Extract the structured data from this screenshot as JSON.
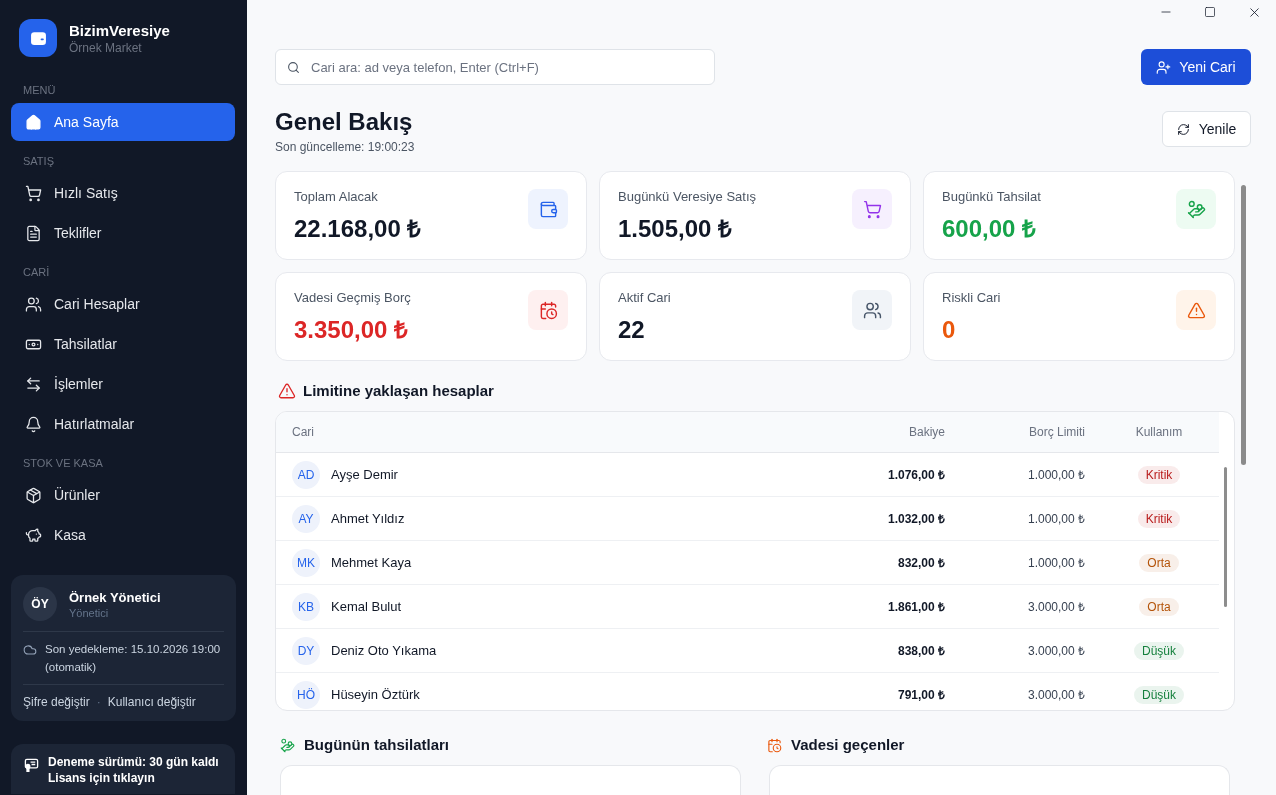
{
  "sidebar": {
    "app_name": "BizimVeresiye",
    "store_name": "Örnek Market",
    "sections": [
      {
        "label": "MENÜ",
        "items": [
          {
            "label": "Ana Sayfa",
            "selected": true
          }
        ]
      },
      {
        "label": "SATIŞ",
        "items": [
          {
            "label": "Hızlı Satış",
            "selected": false
          },
          {
            "label": "Teklifler",
            "selected": false
          }
        ]
      },
      {
        "label": "CARİ",
        "items": [
          {
            "label": "Cari Hesaplar",
            "selected": false
          },
          {
            "label": "Tahsilatlar",
            "selected": false
          },
          {
            "label": "İşlemler",
            "selected": false
          },
          {
            "label": "Hatırlatmalar",
            "selected": false
          }
        ]
      },
      {
        "label": "STOK VE KASA",
        "items": [
          {
            "label": "Ürünler",
            "selected": false
          },
          {
            "label": "Kasa",
            "selected": false
          }
        ]
      }
    ],
    "user": {
      "initials": "ÖY",
      "name": "Örnek Yönetici",
      "role": "Yönetici",
      "backup": "Son yedekleme: 15.10.2026 19:00 (otomatik)",
      "links": [
        "Şifre değiştir",
        "Kullanıcı değiştir"
      ],
      "link_separator": "·"
    },
    "trial": {
      "title": "Deneme sürümü: 30 gün kaldı",
      "action": "Lisans için tıklayın"
    }
  },
  "search": {
    "placeholder": "Cari ara: ad veya telefon, Enter (Ctrl+F)"
  },
  "new_account_button": "Yeni Cari",
  "header": {
    "title": "Genel Bakış",
    "updated": "Son güncelleme: 19:00:23",
    "refresh_button": "Yenile"
  },
  "stats": [
    {
      "label": "Toplam Alacak",
      "value": "22.168,00 ₺",
      "color": "#111827"
    },
    {
      "label": "Bugünkü Veresiye Satış",
      "value": "1.505,00 ₺",
      "color": "#111827"
    },
    {
      "label": "Bugünkü Tahsilat",
      "value": "600,00 ₺",
      "color": "#16a34a"
    },
    {
      "label": "Vadesi Geçmiş Borç",
      "value": "3.350,00 ₺",
      "color": "#dc2626"
    },
    {
      "label": "Aktif Cari",
      "value": "22",
      "color": "#111827"
    },
    {
      "label": "Riskli Cari",
      "value": "0",
      "color": "#ea580c"
    }
  ],
  "approaching_limit": {
    "title": "Limitine yaklaşan hesaplar",
    "columns": [
      "Cari",
      "Bakiye",
      "Borç Limiti",
      "Kullanım"
    ],
    "rows": [
      {
        "initials": "AD",
        "name": "Ayşe Demir",
        "balance": "1.076,00 ₺",
        "limit": "1.000,00 ₺",
        "usage": {
          "label": "Kritik",
          "color": "#b91c1c"
        }
      },
      {
        "initials": "AY",
        "name": "Ahmet Yıldız",
        "balance": "1.032,00 ₺",
        "limit": "1.000,00 ₺",
        "usage": {
          "label": "Kritik",
          "color": "#b91c1c"
        }
      },
      {
        "initials": "MK",
        "name": "Mehmet Kaya",
        "balance": "832,00 ₺",
        "limit": "1.000,00 ₺",
        "usage": {
          "label": "Orta",
          "color": "#b45309"
        }
      },
      {
        "initials": "KB",
        "name": "Kemal Bulut",
        "balance": "1.861,00 ₺",
        "limit": "3.000,00 ₺",
        "usage": {
          "label": "Orta",
          "color": "#b45309"
        }
      },
      {
        "initials": "DY",
        "name": "Deniz Oto Yıkama",
        "balance": "838,00 ₺",
        "limit": "3.000,00 ₺",
        "usage": {
          "label": "Düşük",
          "color": "#15803d"
        }
      },
      {
        "initials": "HÖ",
        "name": "Hüseyin Öztürk",
        "balance": "791,00 ₺",
        "limit": "3.000,00 ₺",
        "usage": {
          "label": "Düşük",
          "color": "#15803d"
        }
      }
    ]
  },
  "todays_collections": {
    "title": "Bugünün tahsilatları"
  },
  "overdue": {
    "title": "Vadesi geçenler"
  }
}
